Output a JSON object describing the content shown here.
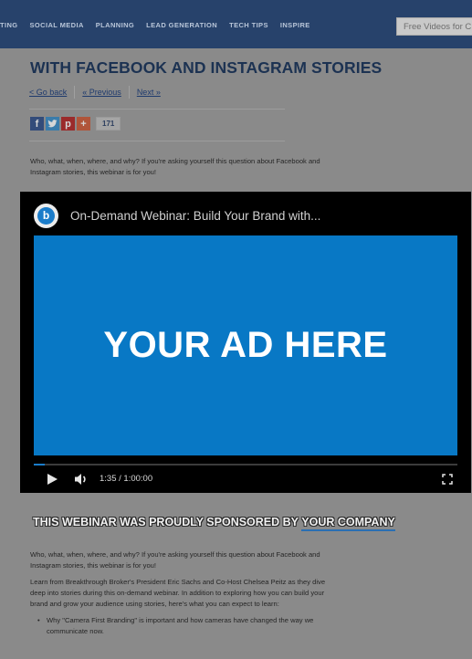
{
  "nav": {
    "links": [
      "TING",
      "SOCIAL MEDIA",
      "PLANNING",
      "LEAD GENERATION",
      "TECH TIPS",
      "INSPIRE"
    ],
    "search_placeholder": "Free Videos for C"
  },
  "article": {
    "title": "WITH FACEBOOK AND INSTAGRAM STORIES",
    "go_back": "< Go back",
    "previous": "« Previous",
    "next": "Next »",
    "share_count": "171",
    "intro": "Who, what, when, where, and why? If you're asking yourself this question about Facebook and Instagram stories, this webinar is for you!"
  },
  "player": {
    "title": "On-Demand Webinar: Build Your Brand with...",
    "ad_text": "YOUR AD HERE",
    "time": "1:35 / 1:00:00",
    "progress": 0.026
  },
  "sponsor": {
    "prefix": "THIS WEBINAR WAS PROUDLY SPONSORED BY ",
    "company": "YOUR COMPANY"
  },
  "body": {
    "p1": "Who, what, when, where, and why? If you're asking yourself this question about Facebook and Instagram stories, this webinar is for you!",
    "p2": "Learn from Breakthrough Broker's President Eric Sachs and Co-Host Chelsea Peitz as they dive deep into stories during this on-demand webinar. In addition to exploring how you can build your brand and grow your audience using stories, here's what you can expect to learn:",
    "bullets": [
      "Why \"Camera First Branding\" is important and how cameras have changed the way we communicate now."
    ]
  },
  "colors": {
    "nav_bg": "#27426b",
    "ad_blue": "#0878c5",
    "title_blue": "#1c3252"
  }
}
